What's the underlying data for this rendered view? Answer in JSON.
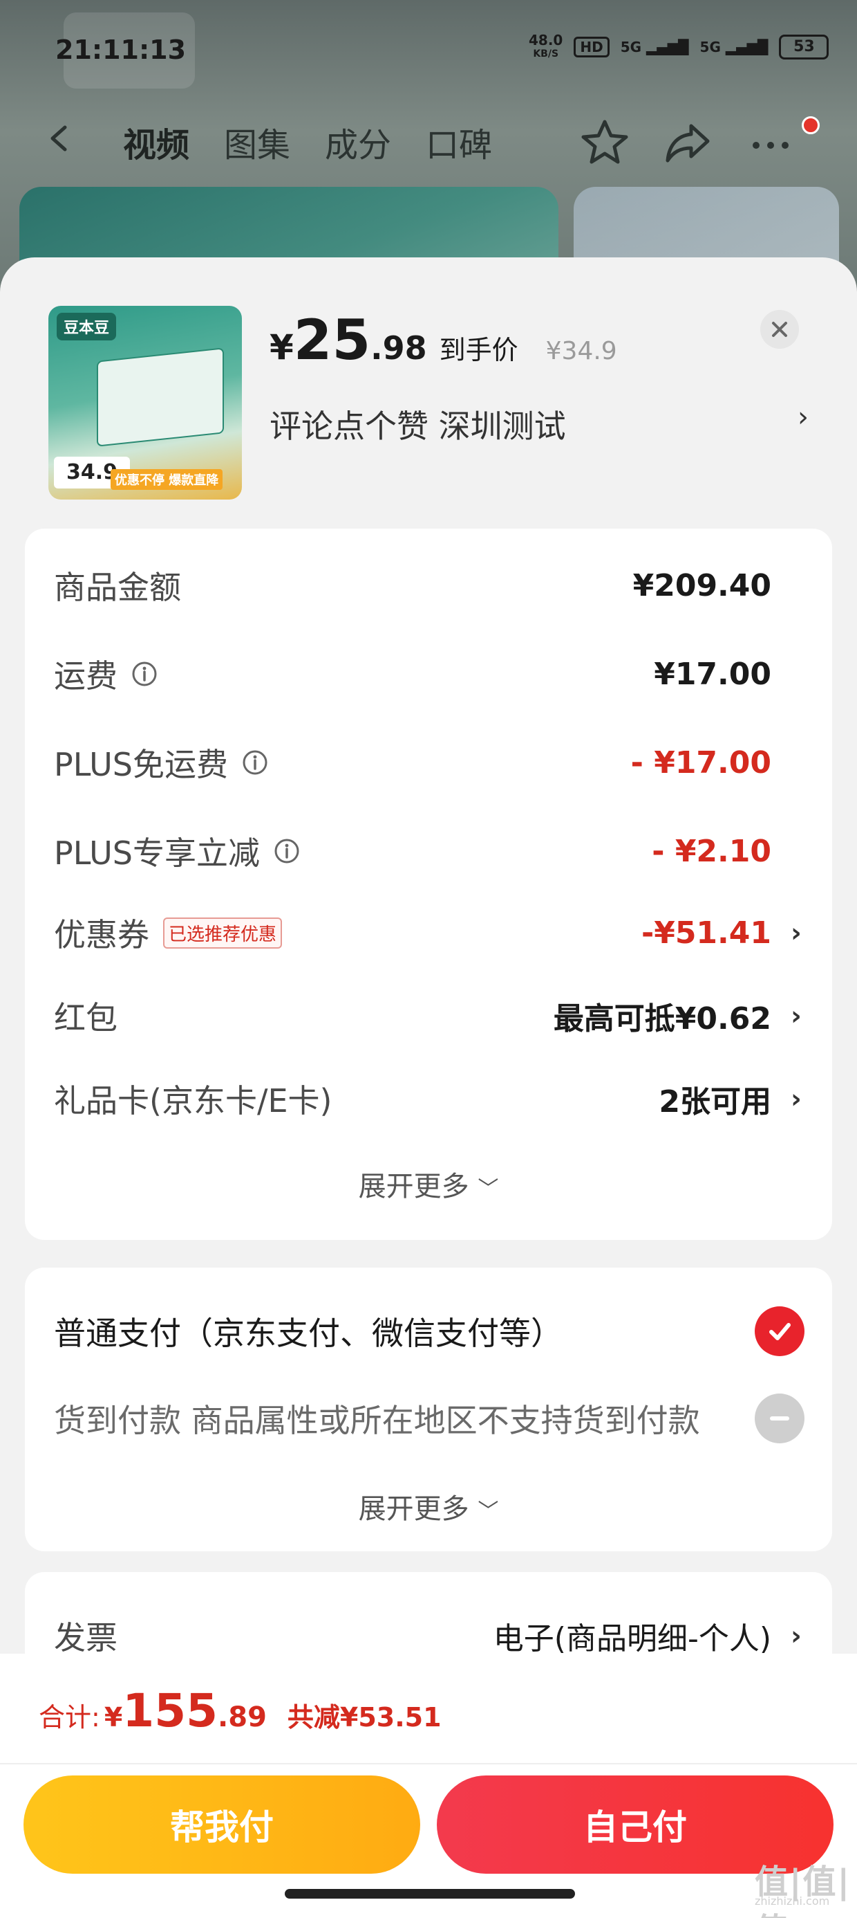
{
  "status_bar": {
    "time": "21:11:13",
    "net_speed_value": "48.0",
    "net_speed_unit": "KB/S",
    "hd": "HD",
    "signal1": "5G",
    "signal2": "5G",
    "battery": "53"
  },
  "nav": {
    "tabs": [
      "视频",
      "图集",
      "成分",
      "口碑"
    ],
    "active_tab": "视频",
    "icons": [
      "star-icon",
      "share-icon",
      "more-icon"
    ]
  },
  "product": {
    "image_brand": "豆本豆",
    "image_price_tag": "34.9",
    "image_strip": "优惠不停 爆款直降",
    "price_currency": "¥",
    "price_int": "25",
    "price_dec": ".98",
    "price_label": "到手价",
    "original_price": "¥34.9",
    "spec": "评论点个赞  深圳测试"
  },
  "summary": {
    "rows": [
      {
        "label": "商品金额",
        "value": "¥209.40"
      },
      {
        "label": "运费",
        "value": "¥17.00"
      },
      {
        "label": "PLUS免运费",
        "value": "- ¥17.00"
      },
      {
        "label": "PLUS专享立减",
        "value": "- ¥2.10"
      },
      {
        "label": "优惠券",
        "badge": "已选推荐优惠",
        "value": "-¥51.41"
      },
      {
        "label": "红包",
        "value": "最高可抵¥0.62"
      },
      {
        "label": "礼品卡(京东卡/E卡)",
        "value": "2张可用"
      }
    ],
    "expand": "展开更多"
  },
  "payment": {
    "options": [
      {
        "label": "普通支付（京东支付、微信支付等）",
        "selected": true
      },
      {
        "label": "货到付款 商品属性或所在地区不支持货到付款",
        "selected": false
      }
    ],
    "expand": "展开更多"
  },
  "invoice": {
    "label": "发票",
    "value": "电子(商品明细-个人)"
  },
  "footer": {
    "total_label": "合计:",
    "total_currency": "¥",
    "total_int": "155",
    "total_dec": ".89",
    "saved": "共减¥53.51",
    "help_pay": "帮我付",
    "self_pay": "自己付",
    "watermark": "值|值|值",
    "watermark_url": "zhizhizhi.com"
  },
  "colors": {
    "accent_red": "#d42a1e",
    "help_button": "#ffb815",
    "self_button": "#f5323a"
  }
}
